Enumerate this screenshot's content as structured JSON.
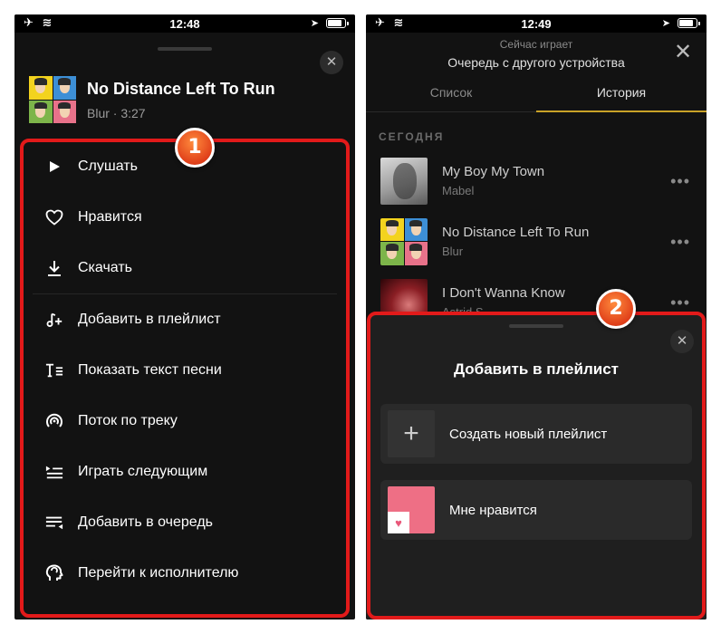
{
  "left_screen": {
    "status": {
      "time": "12:48"
    },
    "track": {
      "title": "No Distance Left To Run",
      "subtitle": "Blur · 3:27"
    },
    "close_glyph": "✕",
    "menu_items": [
      {
        "label": "Слушать",
        "icon": "play-icon"
      },
      {
        "label": "Нравится",
        "icon": "heart-icon"
      },
      {
        "label": "Скачать",
        "icon": "download-icon"
      },
      {
        "label": "Добавить в плейлист",
        "icon": "add-to-playlist-icon"
      },
      {
        "label": "Показать текст песни",
        "icon": "lyrics-icon"
      },
      {
        "label": "Поток по треку",
        "icon": "radio-icon"
      },
      {
        "label": "Играть следующим",
        "icon": "play-next-icon"
      },
      {
        "label": "Добавить в очередь",
        "icon": "add-to-queue-icon"
      },
      {
        "label": "Перейти к исполнителю",
        "icon": "artist-icon"
      }
    ]
  },
  "right_screen": {
    "status": {
      "time": "12:49"
    },
    "header": {
      "label": "Сейчас играет",
      "title": "Очередь с другого устройства",
      "close_glyph": "✕"
    },
    "tabs": [
      {
        "label": "Список",
        "active": false
      },
      {
        "label": "История",
        "active": true
      }
    ],
    "section_label": "СЕГОДНЯ",
    "history": [
      {
        "title": "My Boy My Town",
        "artist": "Mabel"
      },
      {
        "title": "No Distance Left To Run",
        "artist": "Blur"
      },
      {
        "title": "I Don't Wanna Know",
        "artist": "Astrid S"
      }
    ],
    "more_glyph": "•••",
    "sheet": {
      "title": "Добавить в плейлист",
      "close_glyph": "✕",
      "options": [
        {
          "label": "Создать новый плейлист",
          "icon": "plus-icon"
        },
        {
          "label": "Мне нравится",
          "icon": "liked-playlist-cover"
        }
      ],
      "plus_glyph": "+",
      "heart_glyph": "♥"
    }
  },
  "annotations": {
    "badge_1": "1",
    "badge_2": "2",
    "color": "#e21a1a"
  },
  "colors": {
    "background": "#121212",
    "accent": "#c9a227",
    "sheet": "#1f1f1f"
  }
}
